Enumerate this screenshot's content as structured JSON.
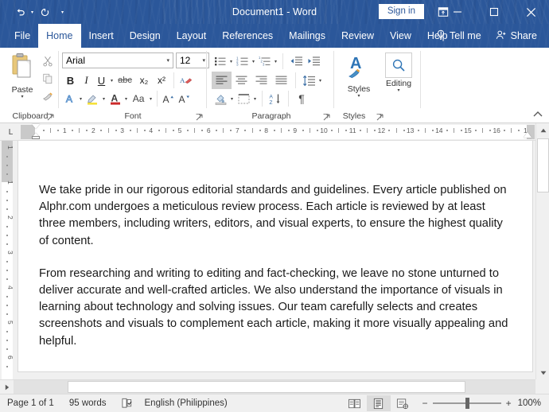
{
  "titlebar": {
    "document_title": "Document1  -  Word",
    "signin_label": "Sign in",
    "qat": [
      {
        "name": "undo",
        "glyph": "↶"
      },
      {
        "name": "redo",
        "glyph": "↻"
      },
      {
        "name": "customize-quick-access-toolbar",
        "glyph": "▾"
      }
    ],
    "window_controls": [
      {
        "name": "ribbon-display-options",
        "glyph": "⌸"
      },
      {
        "name": "minimize",
        "glyph": "─"
      },
      {
        "name": "maximize",
        "glyph": "□"
      },
      {
        "name": "close",
        "glyph": "✕"
      }
    ]
  },
  "tabs": [
    {
      "label": "File",
      "active": false
    },
    {
      "label": "Home",
      "active": true
    },
    {
      "label": "Insert",
      "active": false
    },
    {
      "label": "Design",
      "active": false
    },
    {
      "label": "Layout",
      "active": false
    },
    {
      "label": "References",
      "active": false
    },
    {
      "label": "Mailings",
      "active": false
    },
    {
      "label": "Review",
      "active": false
    },
    {
      "label": "View",
      "active": false
    },
    {
      "label": "Help",
      "active": false
    }
  ],
  "right_commands": [
    {
      "label": "Tell me",
      "icon": "lightbulb-icon"
    },
    {
      "label": "Share",
      "icon": "share-person-icon"
    }
  ],
  "ribbon": {
    "groups": [
      {
        "label": "Clipboard"
      },
      {
        "label": "Font"
      },
      {
        "label": "Paragraph"
      },
      {
        "label": "Styles"
      }
    ],
    "clipboard": {
      "paste_label": "Paste",
      "cut_title": "Cut",
      "copy_title": "Copy",
      "format_painter_title": "Format Painter"
    },
    "font": {
      "font_name": "Arial",
      "font_size": "12",
      "bold": "B",
      "italic": "I",
      "underline": "U",
      "strikethrough": "abc",
      "subscript": "x₂",
      "superscript": "x²",
      "clear_formatting": "Clear All Formatting",
      "text_effects": "A",
      "highlight": "Text Highlight Color",
      "font_color": "A",
      "change_case": "Aa",
      "grow_font": "A",
      "shrink_font": "A"
    },
    "paragraph": {
      "bullets": "Bullets",
      "numbering": "Numbering",
      "multilevel": "Multilevel List",
      "decrease_indent": "Decrease Indent",
      "increase_indent": "Increase Indent",
      "align_left": "Align Left",
      "align_center": "Center",
      "align_right": "Align Right",
      "justify": "Justify",
      "line_spacing": "Line and Paragraph Spacing",
      "shading": "Shading",
      "borders": "Borders",
      "sort": "Sort",
      "show_marks": "¶"
    },
    "styles": {
      "styles_label": "Styles",
      "editing_label": "Editing"
    },
    "collapse_label": "Collapse the Ribbon"
  },
  "ruler": {
    "horizontal_ticks": [
      "1",
      "2",
      "3",
      "4",
      "5",
      "6",
      "7",
      "8",
      "9",
      "10",
      "11",
      "12",
      "13",
      "14",
      "15",
      "16",
      "1"
    ],
    "vertical_ticks": [
      "1",
      "1",
      "2",
      "3",
      "4",
      "5",
      "6"
    ],
    "tab_selector": "L"
  },
  "document": {
    "paragraphs": [
      "We take pride in our rigorous editorial standards and guidelines. Every article published on Alphr.com undergoes a meticulous review process. Each article is reviewed by at least three members, including writers, editors, and visual experts, to ensure the highest quality of content.",
      "From researching and writing to editing and fact-checking, we leave no stone unturned to deliver accurate and well-crafted articles. We also understand the importance of visuals in learning about technology and solving issues. Our team carefully selects and creates screenshots and visuals to complement each article, making it more visually appealing and helpful."
    ]
  },
  "statusbar": {
    "page": "Page 1 of 1",
    "words": "95 words",
    "proofing_icon": "proofing-errors-icon",
    "language": "English (Philippines)",
    "views": [
      {
        "name": "read-mode",
        "active": false
      },
      {
        "name": "print-layout",
        "active": true
      },
      {
        "name": "web-layout",
        "active": false
      }
    ],
    "zoom_out": "−",
    "zoom_in": "+",
    "zoom_level": "100%"
  },
  "colors": {
    "titlebar_blue": "#2b579a",
    "accent_blue": "#2b579a",
    "page_white": "#ffffff",
    "chrome_grey": "#f0f0f0"
  }
}
